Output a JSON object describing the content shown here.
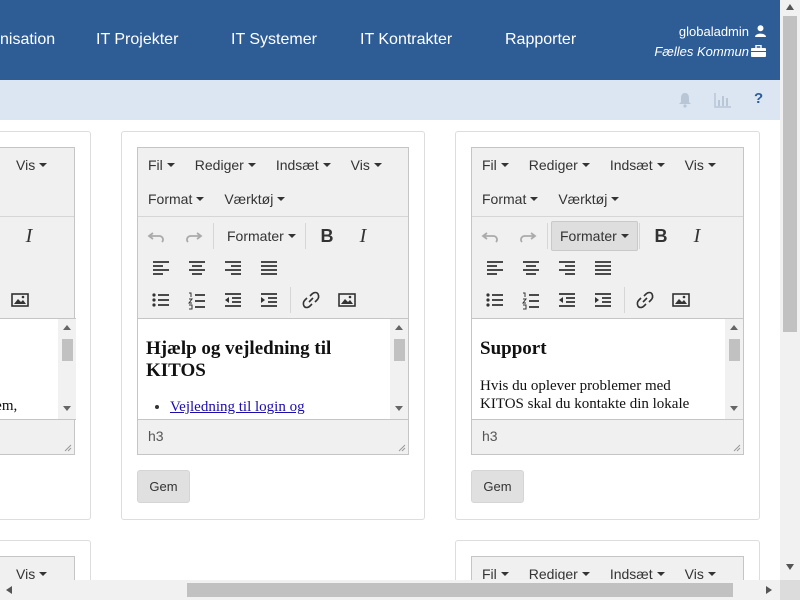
{
  "nav": {
    "items": [
      "nisation",
      "IT Projekter",
      "IT Systemer",
      "IT Kontrakter",
      "Rapporter"
    ],
    "user": "globaladmin",
    "org": "Fælles Kommun"
  },
  "subbar": {
    "help": "?"
  },
  "editor_menu": {
    "fil": "Fil",
    "rediger": "Rediger",
    "indsaet": "Indsæt",
    "vis": "Vis",
    "format": "Format",
    "vaerktoej": "Værktøj"
  },
  "toolbar": {
    "formats_label": "Formater",
    "bold": "B",
    "italic": "I"
  },
  "panel_left": {
    "menu_vis": "Vis",
    "italic": "I",
    "content_fragment": "tem,",
    "bottom_vis": "Vis"
  },
  "panel_help": {
    "heading": "Hjælp og vejledning til KITOS",
    "link": "Vejledning til login og",
    "status": "h3",
    "save": "Gem"
  },
  "panel_support": {
    "heading": "Support",
    "body": "Hvis du oplever problemer med KITOS skal du kontakte din lokale",
    "status": "h3",
    "save": "Gem"
  },
  "icons": {
    "user": "user-icon",
    "briefcase": "briefcase-icon",
    "bell": "bell-icon",
    "chart": "bar-chart-icon",
    "undo": "undo-icon",
    "redo": "redo-icon",
    "align_left": "align-left-icon",
    "align_center": "align-center-icon",
    "align_right": "align-right-icon",
    "justify": "align-justify-icon",
    "bullet_list": "bullet-list-icon",
    "numbered_list": "numbered-list-icon",
    "outdent": "outdent-icon",
    "indent": "indent-icon",
    "link": "link-icon",
    "image": "image-icon"
  },
  "colors": {
    "nav_bg": "#2e5c95",
    "subbar_bg": "#dce6f3",
    "link": "#1a0dab"
  }
}
